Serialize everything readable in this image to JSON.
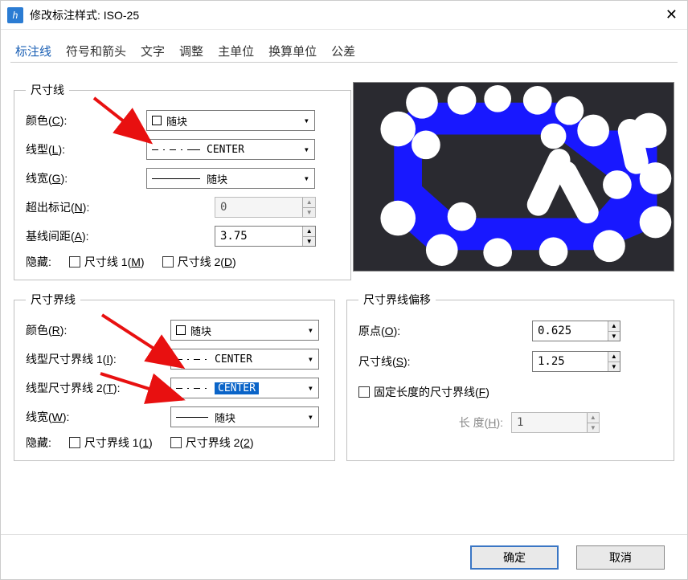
{
  "window": {
    "title": "修改标注样式: ISO-25"
  },
  "tabs": {
    "t1": "标注线",
    "t2": "符号和箭头",
    "t3": "文字",
    "t4": "调整",
    "t5": "主单位",
    "t6": "换算单位",
    "t7": "公差"
  },
  "dimline": {
    "legend": "尺寸线",
    "color_label": "颜色(",
    "color_key": "C",
    "close": "):",
    "color_value": "随块",
    "linetype_label": "线型(",
    "linetype_key": "L",
    "linetype_value": "CENTER",
    "lineweight_label": "线宽(",
    "lineweight_key": "G",
    "lineweight_value": "随块",
    "extend_label": "超出标记(",
    "extend_key": "N",
    "extend_value": "0",
    "baseline_label": "基线间距(",
    "baseline_key": "A",
    "baseline_value": "3.75",
    "hide_label": "隐藏:",
    "hide1": "尺寸线 1(",
    "hide1_key": "M",
    "hide2": "尺寸线 2(",
    "hide2_key": "D",
    "hide_close": ")"
  },
  "extline": {
    "legend": "尺寸界线",
    "color_label": "颜色(",
    "color_key": "R",
    "color_value": "随块",
    "lt1_label": "线型尺寸界线 1(",
    "lt1_key": "I",
    "lt1_value": "CENTER",
    "lt2_label": "线型尺寸界线 2(",
    "lt2_key": "T",
    "lt2_value": "CENTER",
    "lw_label": "线宽(",
    "lw_key": "W",
    "lw_value": "随块",
    "hide_label": "隐藏:",
    "hide1": "尺寸界线 1(",
    "hide1_key": "1",
    "hide2": "尺寸界线 2(",
    "hide2_key": "2",
    "hide_close": ")"
  },
  "offset": {
    "legend": "尺寸界线偏移",
    "origin_label": "原点(",
    "origin_key": "O",
    "origin_close": "):",
    "origin_value": "0.625",
    "dim_label": "尺寸线(",
    "dim_key": "S",
    "dim_close": "):",
    "dim_value": "1.25",
    "fixed_label": "固定长度的尺寸界线(",
    "fixed_key": "F",
    "fixed_close": ")",
    "len_label": "长 度(",
    "len_key": "H",
    "len_close": "):",
    "len_value": "1"
  },
  "footer": {
    "ok": "确定",
    "cancel": "取消"
  }
}
